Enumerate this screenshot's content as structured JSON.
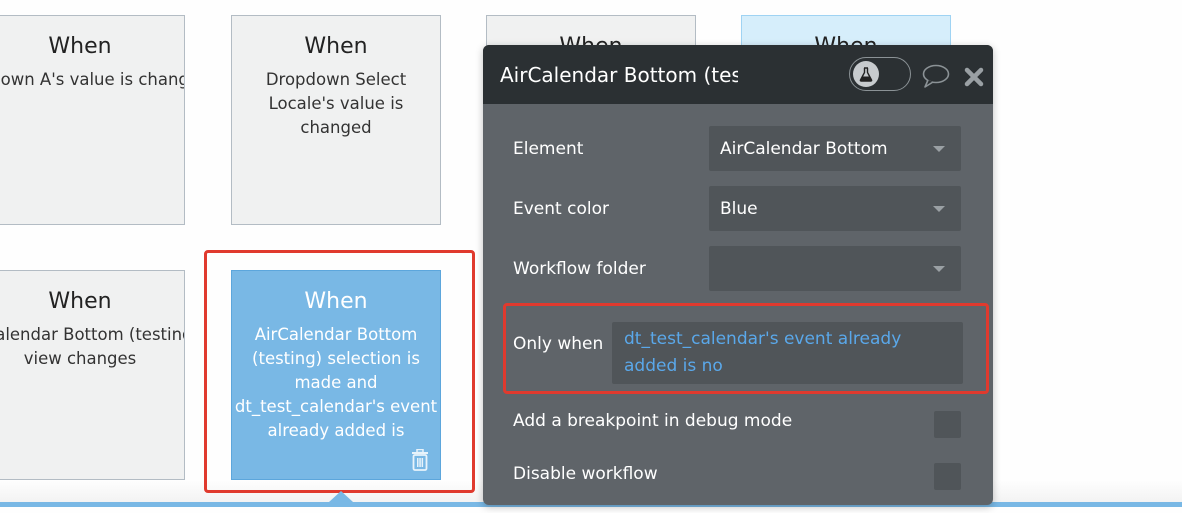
{
  "canvas": {
    "cards": [
      {
        "when": "When",
        "desc": "Dropdown A's value is changed",
        "style": "default"
      },
      {
        "when": "When",
        "desc": "Dropdown Select Locale's value is changed",
        "style": "default"
      },
      {
        "when": "When",
        "desc": "",
        "style": "default"
      },
      {
        "when": "When",
        "desc": "",
        "style": "light-blue"
      },
      {
        "when": "When",
        "desc": "AirCalendar Bottom (testing) view changes",
        "style": "default"
      },
      {
        "when": "When",
        "desc": "AirCalendar Bottom (testing) selection is made and dt_test_calendar's event already added is",
        "style": "selected"
      }
    ],
    "selected_card_actions": {
      "delete_icon": "trash-icon"
    }
  },
  "panel": {
    "title": "AirCalendar Bottom (testing) selection is made",
    "header_icons": [
      "debug-flask-toggle-icon",
      "comment-icon",
      "close-icon"
    ],
    "fields": {
      "element": {
        "label": "Element",
        "value": "AirCalendar Bottom"
      },
      "event_color": {
        "label": "Event color",
        "value": "Blue"
      },
      "workflow_folder": {
        "label": "Workflow folder",
        "value": ""
      },
      "only_when": {
        "label": "Only when",
        "value": "dt_test_calendar's event already added is no"
      },
      "breakpoint": {
        "label": "Add a breakpoint in debug mode",
        "checked": false
      },
      "disable": {
        "label": "Disable workflow",
        "checked": false
      }
    }
  },
  "colors": {
    "accent_blue": "#79b8e5",
    "highlight_red": "#e03a2e",
    "panel_bg": "#5f6469",
    "panel_header_bg": "#2b3033",
    "condition_text": "#5aa8ea"
  }
}
